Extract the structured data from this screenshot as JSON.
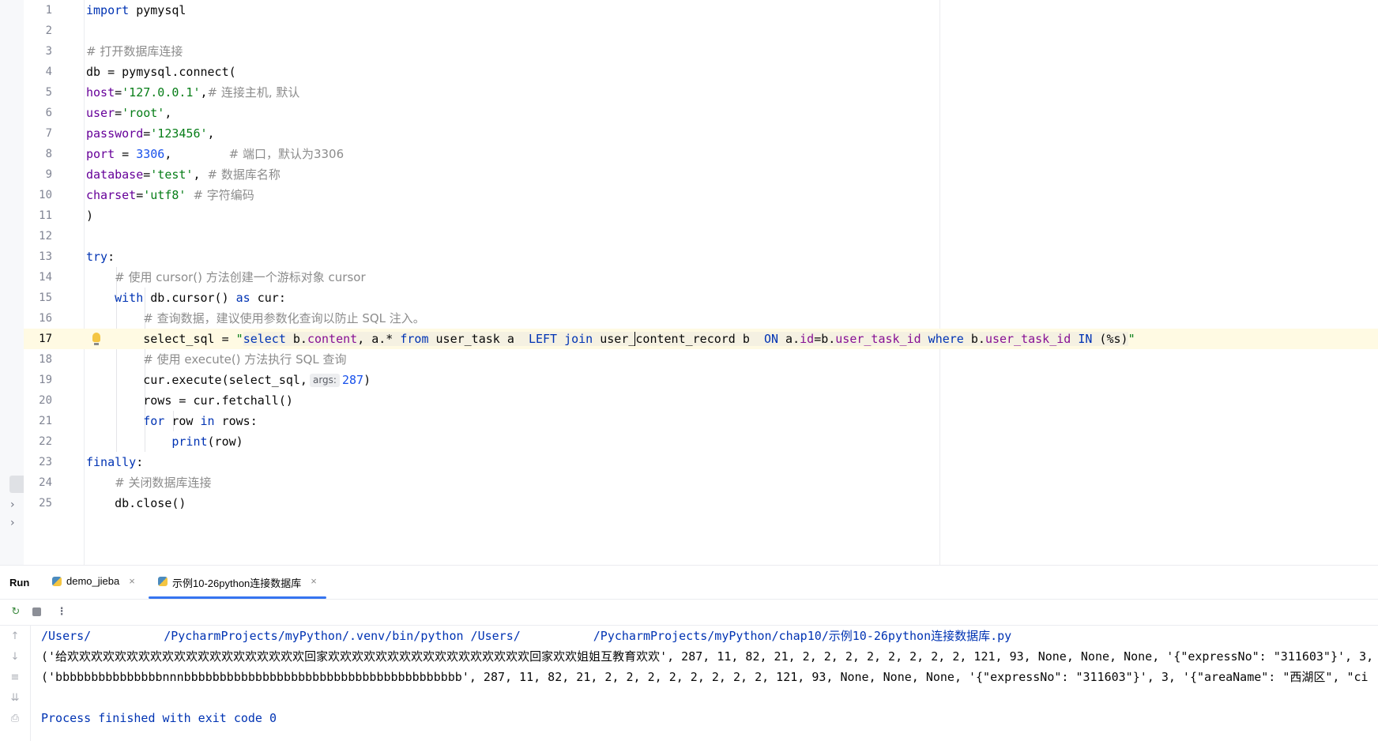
{
  "editor": {
    "active_line": 17,
    "lines": [
      {
        "n": "1"
      },
      {
        "n": "2"
      },
      {
        "n": "3"
      },
      {
        "n": "4"
      },
      {
        "n": "5"
      },
      {
        "n": "6"
      },
      {
        "n": "7"
      },
      {
        "n": "8"
      },
      {
        "n": "9"
      },
      {
        "n": "10"
      },
      {
        "n": "11"
      },
      {
        "n": "12"
      },
      {
        "n": "13"
      },
      {
        "n": "14"
      },
      {
        "n": "15"
      },
      {
        "n": "16"
      },
      {
        "n": "17"
      },
      {
        "n": "18"
      },
      {
        "n": "19"
      },
      {
        "n": "20"
      },
      {
        "n": "21"
      },
      {
        "n": "22"
      },
      {
        "n": "23"
      },
      {
        "n": "24"
      },
      {
        "n": "25"
      }
    ],
    "code": {
      "l1_kw": "import",
      "l1_mod": " pymysql",
      "l3_comment": "# 打开数据库连接",
      "l4": "db = pymysql.connect(",
      "l5_key": "host",
      "l5_val": "'127.0.0.1'",
      "l5_comment": "# 连接主机, 默认",
      "l6_key": "user",
      "l6_val": "'root'",
      "l7_key": "password",
      "l7_val": "'123456'",
      "l8_key": "port",
      "l8_val": "3306",
      "l8_comment": "# 端口，默认为3306",
      "l9_key": "database",
      "l9_val": "'test'",
      "l9_comment": "# 数据库名称",
      "l10_key": "charset",
      "l10_val": "'utf8'",
      "l10_comment": "# 字符编码",
      "l11": ")",
      "l13_kw": "try",
      "l14_comment": "# 使用 cursor() 方法创建一个游标对象 cursor",
      "l15_kw1": "with",
      "l15_mid": " db.cursor() ",
      "l15_kw2": "as",
      "l15_end": " cur:",
      "l16_comment": "# 查询数据，建议使用参数化查询以防止 SQL 注入。",
      "l17_var": "select_sql = ",
      "l17_q1": "\"",
      "l17_s1": "select",
      "l17_s2": " b.",
      "l17_s3": "content",
      "l17_s4": ", a.* ",
      "l17_s5": "from",
      "l17_s6": " user_task a  ",
      "l17_s7": "LEFT join",
      "l17_s8": " user_",
      "l17_s9": "content_record b  ",
      "l17_s10": "ON",
      "l17_s11": " a.",
      "l17_s12": "id",
      "l17_s13": "=b.",
      "l17_s14": "user_task_id",
      "l17_s15": " where",
      "l17_s16": " b.",
      "l17_s17": "user_task_id",
      "l17_s18": " IN",
      "l17_s19": " (%s)",
      "l17_q2": "\"",
      "l18_comment": "# 使用 execute() 方法执行 SQL 查询",
      "l19_a": "cur.execute(select_sql,",
      "l19_hint": "args:",
      "l19_num": "287",
      "l19_b": ")",
      "l20": "rows = cur.fetchall()",
      "l21_kw1": "for",
      "l21_mid": " row ",
      "l21_kw2": "in",
      "l21_end": " rows:",
      "l22_fn": "print",
      "l22_end": "(row)",
      "l23_kw": "finally",
      "l24_comment": "# 关闭数据库连接",
      "l25": "db.close()"
    }
  },
  "run_panel": {
    "title": "Run",
    "tabs": [
      {
        "label": "demo_jieba",
        "close": "×"
      },
      {
        "label": "示例10-26python连接数据库",
        "close": "×"
      }
    ],
    "console": {
      "cmd_a": "/Users/",
      "cmd_b": "/PycharmProjects/myPython/.venv/bin/python /Users/",
      "cmd_c": "/PycharmProjects/myPython/chap10/示例10-26python连接数据库.py",
      "row1": "('给欢欢欢欢欢欢欢欢欢欢欢欢欢欢欢欢欢欢欢欢回家欢欢欢欢欢欢欢欢欢欢欢欢欢欢欢欢欢回家欢欢姐姐互教育欢欢', 287, 11, 82, 21, 2, 2, 2, 2, 2, 2, 2, 2, 121, 93, None, None, None, '{\"expressNo\": \"311603\"}', 3, '{\"areaName\": \"西湖区\", \"ci",
      "row2": "('bbbbbbbbbbbbbbbnnnbbbbbbbbbbbbbbbbbbbbbbbbbbbbbbbbbbbbbbb', 287, 11, 82, 21, 2, 2, 2, 2, 2, 2, 2, 2, 121, 93, None, None, None, '{\"expressNo\": \"311603\"}', 3, '{\"areaName\": \"西湖区\", \"ci",
      "exit": "Process finished with exit code 0"
    }
  },
  "icons": {
    "rerun": "rerun-icon",
    "stop": "stop-icon",
    "more": "more-icon",
    "scroll_up": "arrow-up-icon",
    "scroll_down": "arrow-down-icon",
    "soft_wrap": "soft-wrap-icon",
    "scroll_end": "scroll-to-end-icon",
    "print": "print-icon",
    "bulb": "lightbulb-icon"
  },
  "colors": {
    "keyword": "#0033b3",
    "string": "#067d17",
    "number": "#1750eb",
    "comment": "#8c8c8c",
    "kwarg": "#660099",
    "active_line": "#fffae3",
    "tab_accent": "#3574f0"
  }
}
